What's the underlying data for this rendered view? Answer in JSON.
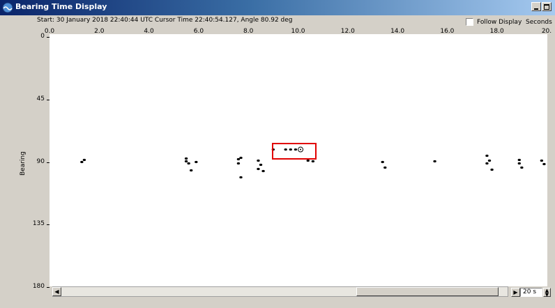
{
  "window": {
    "title": "Bearing Time Display",
    "info": "Start: 30 January 2018 22:40:44 UTC   Cursor Time 22:40:54.127, Angle 80.92 deg",
    "follow_display_label": "Follow Display",
    "follow_display_checked": false,
    "units_label": "Seconds"
  },
  "x_axis": {
    "ticks": [
      "0.0",
      "2.0",
      "4.0",
      "6.0",
      "8.0",
      "10.0",
      "12.0",
      "14.0",
      "16.0",
      "18.0",
      "20."
    ]
  },
  "y_axis": {
    "title": "Bearing",
    "ticks": [
      "0",
      "45",
      "90",
      "135",
      "180"
    ]
  },
  "controls": {
    "time_span": "20 s"
  },
  "detections": [
    {
      "t": 1.4,
      "b": 88.5
    },
    {
      "t": 1.3,
      "b": 90.0
    },
    {
      "t": 5.5,
      "b": 87.5
    },
    {
      "t": 5.5,
      "b": 89.5
    },
    {
      "t": 5.6,
      "b": 91.0
    },
    {
      "t": 5.9,
      "b": 90.0
    },
    {
      "t": 5.7,
      "b": 96.0
    },
    {
      "t": 7.6,
      "b": 88.0
    },
    {
      "t": 7.6,
      "b": 91.0
    },
    {
      "t": 7.7,
      "b": 87.0
    },
    {
      "t": 7.7,
      "b": 101.0
    },
    {
      "t": 8.4,
      "b": 89.0
    },
    {
      "t": 8.5,
      "b": 92.0
    },
    {
      "t": 8.4,
      "b": 95.0
    },
    {
      "t": 8.6,
      "b": 96.5
    },
    {
      "t": 9.0,
      "b": 81.0
    },
    {
      "t": 9.5,
      "b": 81.0
    },
    {
      "t": 9.7,
      "b": 81.0
    },
    {
      "t": 9.9,
      "b": 81.0
    },
    {
      "t": 10.4,
      "b": 89.0
    },
    {
      "t": 10.6,
      "b": 89.5
    },
    {
      "t": 13.4,
      "b": 90.0
    },
    {
      "t": 13.5,
      "b": 94.0
    },
    {
      "t": 15.5,
      "b": 89.5
    },
    {
      "t": 17.6,
      "b": 85.5
    },
    {
      "t": 17.7,
      "b": 89.0
    },
    {
      "t": 17.6,
      "b": 91.0
    },
    {
      "t": 17.8,
      "b": 95.5
    },
    {
      "t": 18.9,
      "b": 88.5
    },
    {
      "t": 18.9,
      "b": 91.0
    },
    {
      "t": 19.0,
      "b": 94.0
    },
    {
      "t": 19.8,
      "b": 89.0
    },
    {
      "t": 19.9,
      "b": 91.5
    }
  ],
  "marker": {
    "t": 10.1,
    "b": 81.0
  }
}
